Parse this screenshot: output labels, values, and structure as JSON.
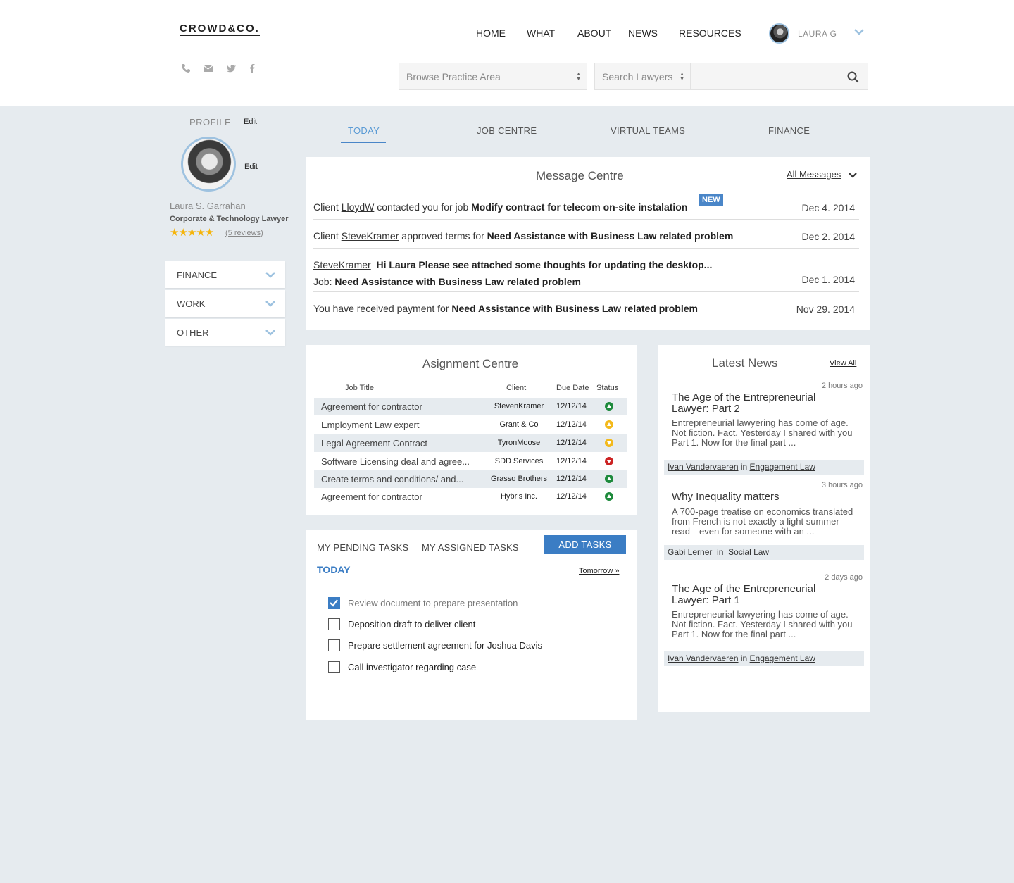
{
  "header": {
    "logo": "CROWD&CO.",
    "nav": [
      "HOME",
      "WHAT",
      "ABOUT",
      "NEWS",
      "RESOURCES"
    ],
    "user_name": "LAURA G",
    "practice_placeholder": "Browse Practice Area",
    "lawyers_placeholder": "Search Lawyers",
    "social_icons": [
      "phone-icon",
      "mail-icon",
      "twitter-icon",
      "facebook-icon"
    ]
  },
  "profile": {
    "label": "PROFILE",
    "edit": "Edit",
    "name": "Laura S. Garrahan",
    "title": "Corporate & Technology Lawyer",
    "stars": "★★★★★",
    "rating": 5,
    "reviews": "(5 reviews)"
  },
  "side_menu": [
    "FINANCE",
    "WORK",
    "OTHER"
  ],
  "tabs": [
    "TODAY",
    "JOB CENTRE",
    "VIRTUAL TEAMS",
    "FINANCE"
  ],
  "messages": {
    "title": "Message Centre",
    "all": "All Messages",
    "new_badge": "NEW",
    "rows": [
      {
        "p1": "Client ",
        "link": "LloydW",
        "p2": " contacted you for job ",
        "bold": "Modify contract for telecom on-site instalation",
        "date": "Dec 4. 2014"
      },
      {
        "p1": "Client ",
        "link": "SteveKramer",
        "p2": " approved terms for ",
        "bold": "Need Assistance with Business Law related problem",
        "date": "Dec 2. 2014"
      },
      {
        "link": "SteveKramer",
        "bold1": "Hi Laura Please see attached some thoughts for updating the desktop...",
        "job_label": "Job: ",
        "bold2": "Need Assistance with Business Law related problem",
        "date": "Dec 1. 2014"
      },
      {
        "p1": "You have received payment for ",
        "bold": "Need Assistance with Business Law related problem",
        "date": "Nov 29. 2014"
      }
    ]
  },
  "assignments": {
    "title": "Asignment Centre",
    "headers": [
      "Job Title",
      "Client",
      "Due Date",
      "Status"
    ],
    "rows": [
      {
        "job": "Agreement for contractor",
        "client": "StevenKramer",
        "due": "12/12/14",
        "status": "up"
      },
      {
        "job": "Employment Law expert",
        "client": "Grant & Co",
        "due": "12/12/14",
        "status": "up-warn"
      },
      {
        "job": "Legal Agreement Contract",
        "client": "TyronMoose",
        "due": "12/12/14",
        "status": "down-warn"
      },
      {
        "job": "Software Licensing deal and agree...",
        "client": "SDD Services",
        "due": "12/12/14",
        "status": "down"
      },
      {
        "job": "Create terms and conditions/ and...",
        "client": "Grasso Brothers",
        "due": "12/12/14",
        "status": "up"
      },
      {
        "job": "Agreement for contractor",
        "client": "Hybris Inc.",
        "due": "12/12/14",
        "status": "up"
      }
    ],
    "status_colors": {
      "up": "#1e8a3c",
      "up-warn": "#f3b91b",
      "down-warn": "#f3b91b",
      "down": "#cc2222"
    }
  },
  "tasks": {
    "tab_pending": "MY PENDING TASKS",
    "tab_assigned": "MY ASSIGNED TASKS",
    "add": "ADD TASKS",
    "today": "TODAY",
    "tomorrow": "Tomorrow »",
    "items": [
      {
        "text": "Review document to prepare presentation",
        "done": true
      },
      {
        "text": "Deposition draft to deliver client",
        "done": false
      },
      {
        "text": "Prepare settlement agreement for Joshua Davis",
        "done": false
      },
      {
        "text": "Call investigator regarding case",
        "done": false
      }
    ]
  },
  "news": {
    "title": "Latest News",
    "view_all": "View All",
    "in_word": "in",
    "items": [
      {
        "time": "2 hours ago",
        "title": "The Age of the Entrepreneurial Lawyer: Part 2",
        "excerpt": "Entrepreneurial lawyering has come of age. Not fiction. Fact. Yesterday I shared with you Part 1. Now for the final part ...",
        "author": "Ivan Vandervaeren",
        "category": "Engagement Law"
      },
      {
        "time": "3 hours ago",
        "title": "Why Inequality matters",
        "excerpt": "A 700-page treatise on economics translated from French is not exactly a light summer read—even for someone with an ...",
        "author": "Gabi Lerner",
        "category": "Social Law"
      },
      {
        "time": "2 days ago",
        "title": "The Age of the Entrepreneurial Lawyer: Part 1",
        "excerpt": "Entrepreneurial lawyering has come of age. Not fiction. Fact. Yesterday I shared with you Part 1. Now for the final part ...",
        "author": "Ivan Vandervaeren",
        "category": "Engagement Law"
      }
    ]
  },
  "colors": {
    "accent": "#3b7dc4",
    "background": "#e6ebef",
    "star": "#f5b40a"
  }
}
